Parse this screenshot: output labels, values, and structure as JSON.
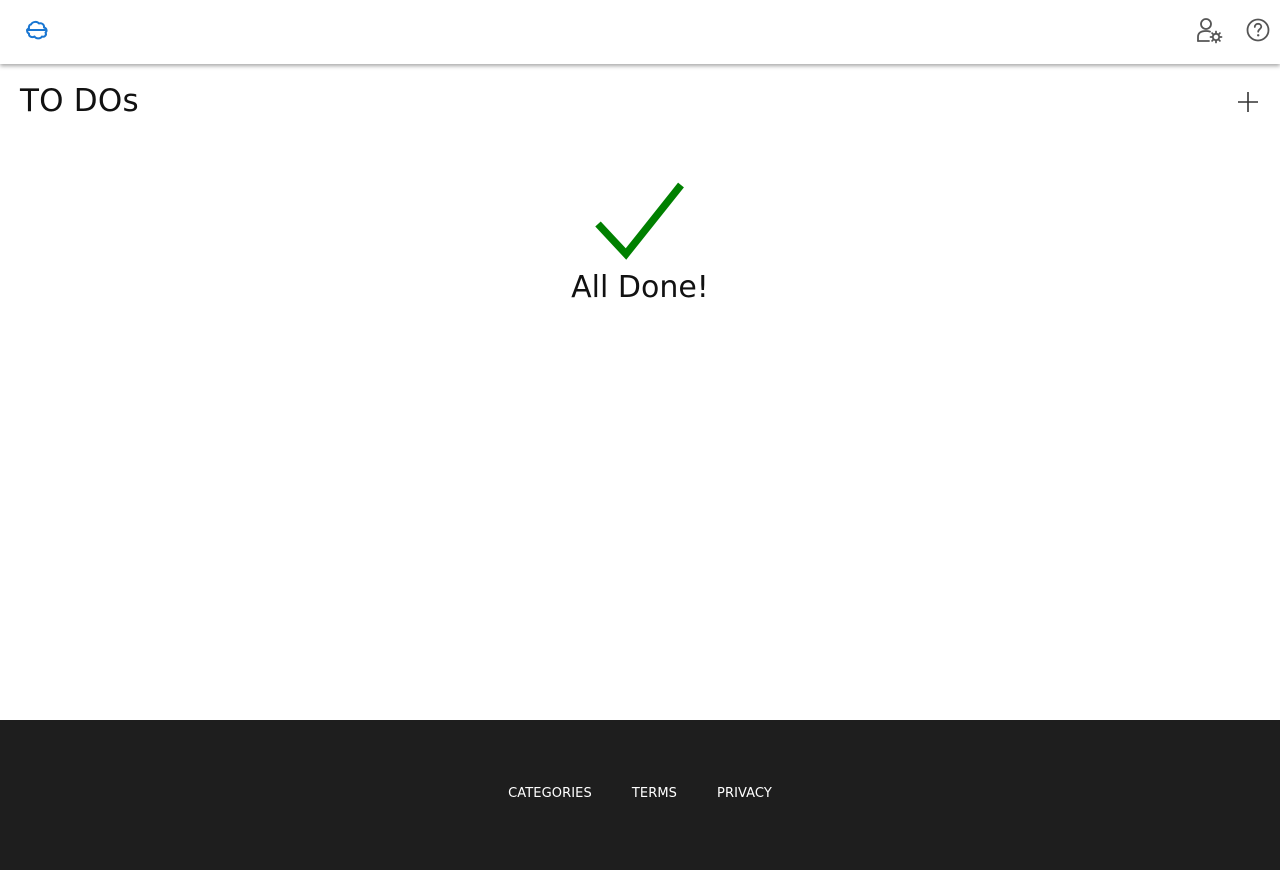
{
  "header": {
    "logo_icon": "cloud-logo-icon",
    "user_settings_icon": "user-gear-icon",
    "help_icon": "question-circle-icon"
  },
  "main": {
    "title": "TO DOs",
    "add_icon": "plus-icon",
    "empty_state": {
      "icon": "checkmark-icon",
      "message": "All Done!"
    }
  },
  "footer": {
    "links": [
      "CATEGORIES",
      "TERMS",
      "PRIVACY"
    ]
  },
  "colors": {
    "brand": "#1976d2",
    "success": "#008000",
    "footer_bg": "#1e1e1e",
    "icon_gray": "#555555"
  }
}
